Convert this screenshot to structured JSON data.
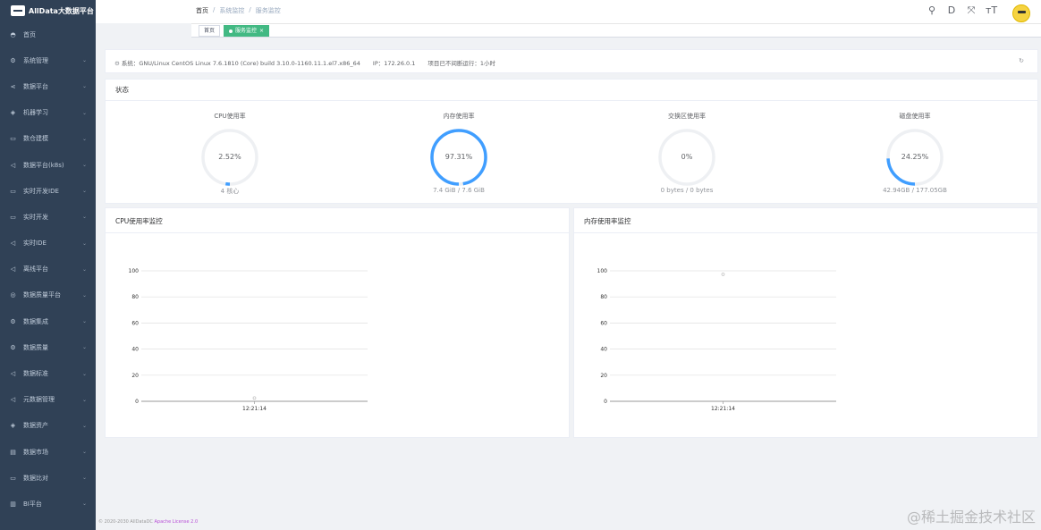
{
  "app": {
    "logo_text": "AllData大数据平台"
  },
  "sidebar": {
    "items": [
      {
        "label": "首页",
        "icon": "dashboard-icon",
        "glyph": "◓",
        "has_arrow": false
      },
      {
        "label": "系统管理",
        "icon": "gear-icon",
        "glyph": "⚙",
        "has_arrow": true
      },
      {
        "label": "数据平台",
        "icon": "share-icon",
        "glyph": "⋖",
        "has_arrow": true
      },
      {
        "label": "机器学习",
        "icon": "cube-icon",
        "glyph": "◈",
        "has_arrow": true
      },
      {
        "label": "数仓建模",
        "icon": "monitor-icon",
        "glyph": "▭",
        "has_arrow": true
      },
      {
        "label": "数据平台(k8s)",
        "icon": "send-icon",
        "glyph": "◁",
        "has_arrow": true
      },
      {
        "label": "实时开发IDE",
        "icon": "monitor-icon",
        "glyph": "▭",
        "has_arrow": true
      },
      {
        "label": "实时开发",
        "icon": "monitor-icon",
        "glyph": "▭",
        "has_arrow": true
      },
      {
        "label": "实时IDE",
        "icon": "send-icon",
        "glyph": "◁",
        "has_arrow": true
      },
      {
        "label": "离线平台",
        "icon": "send-icon",
        "glyph": "◁",
        "has_arrow": true
      },
      {
        "label": "数据质量平台",
        "icon": "user-icon",
        "glyph": "◎",
        "has_arrow": true
      },
      {
        "label": "数据集成",
        "icon": "gear-icon",
        "glyph": "⚙",
        "has_arrow": true
      },
      {
        "label": "数据质量",
        "icon": "gear-icon",
        "glyph": "⚙",
        "has_arrow": true
      },
      {
        "label": "数据标准",
        "icon": "send-icon",
        "glyph": "◁",
        "has_arrow": true
      },
      {
        "label": "元数据管理",
        "icon": "send-icon",
        "glyph": "◁",
        "has_arrow": true
      },
      {
        "label": "数据资产",
        "icon": "cube-icon",
        "glyph": "◈",
        "has_arrow": true
      },
      {
        "label": "数据市场",
        "icon": "table-icon",
        "glyph": "▤",
        "has_arrow": true
      },
      {
        "label": "数据比对",
        "icon": "monitor-icon",
        "glyph": "▭",
        "has_arrow": true
      },
      {
        "label": "BI平台",
        "icon": "bar-chart-icon",
        "glyph": "▥",
        "has_arrow": true
      }
    ]
  },
  "header": {
    "breadcrumb": [
      "首页",
      "/",
      "系统监控",
      "/",
      "服务监控"
    ],
    "tools": [
      {
        "name": "search-icon",
        "glyph": "⚲"
      },
      {
        "name": "document-icon",
        "glyph": "D"
      },
      {
        "name": "fullscreen-icon",
        "glyph": "⤧"
      },
      {
        "name": "font-size-icon",
        "glyph": "тT"
      }
    ]
  },
  "tags": {
    "home": "首页",
    "active": "服务监控",
    "close_glyph": "×"
  },
  "sysinfo": {
    "system": "系统：GNU/Linux CentOS Linux 7.6.1810 (Core) build 3.10.0-1160.11.1.el7.x86_64",
    "ip": "IP：172.26.0.1",
    "uptime": "项目已不间断运行：1小时",
    "refresh_glyph": "↻"
  },
  "status": {
    "title": "状态",
    "gauges": [
      {
        "title": "CPU使用率",
        "value_text": "2.52%",
        "percent": 2.52,
        "footer": "4 核心"
      },
      {
        "title": "内存使用率",
        "value_text": "97.31%",
        "percent": 97.31,
        "footer": "7.4 GiB / 7.6 GiB"
      },
      {
        "title": "交换区使用率",
        "value_text": "0%",
        "percent": 0,
        "footer": "0 bytes / 0 bytes"
      },
      {
        "title": "磁盘使用率",
        "value_text": "24.25%",
        "percent": 24.25,
        "footer": "42.94GB / 177.05GB"
      }
    ]
  },
  "chart_data": [
    {
      "type": "scatter",
      "title": "CPU使用率监控",
      "x": [
        "12:21:14"
      ],
      "values": [
        2.52
      ],
      "ylim": [
        0,
        100
      ],
      "yticks": [
        0,
        20,
        40,
        60,
        80,
        100
      ],
      "xlabel": "",
      "ylabel": ""
    },
    {
      "type": "scatter",
      "title": "内存使用率监控",
      "x": [
        "12:21:14"
      ],
      "values": [
        97.31
      ],
      "ylim": [
        0,
        100
      ],
      "yticks": [
        0,
        20,
        40,
        60,
        80,
        100
      ],
      "xlabel": "",
      "ylabel": ""
    }
  ],
  "footer": {
    "copyright": "© 2020-2030 AllDataDC ",
    "license": "Apache License 2.0"
  },
  "watermark": "@稀土掘金技术社区",
  "colors": {
    "sidebar_bg": "#304156",
    "accent": "#409eff",
    "tag_active": "#42b983"
  }
}
